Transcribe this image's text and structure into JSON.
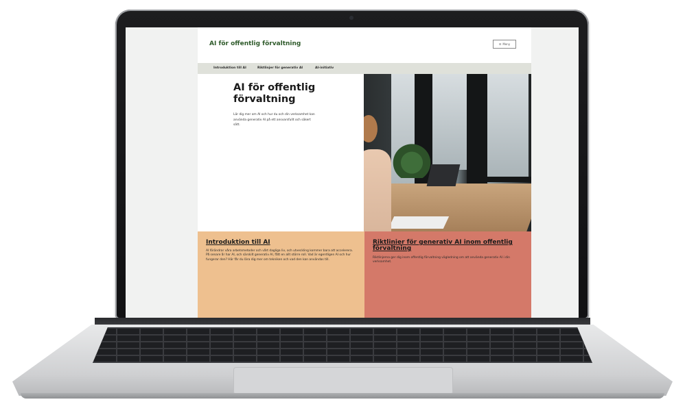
{
  "site": {
    "title": "AI för offentlig förvaltning",
    "menu_label": "Meny"
  },
  "nav": {
    "items": [
      {
        "label": "Introduktion till AI"
      },
      {
        "label": "Riktlinjer för generativ AI"
      },
      {
        "label": "AI-initiativ"
      }
    ]
  },
  "hero": {
    "title": "AI för offentlig förvaltning",
    "text": "Lär dig mer om AI och hur du och din verksamhet kan använda generativ AI på ett ansvarsfullt och säkert sätt."
  },
  "cards": [
    {
      "title": "Introduktion till AI",
      "text": "AI förändrar våra arbetsmetoder och vårt dagliga liv, och utveckling kommer bara att accelerera. På senare år har AI, och särskilt generativ AI, fått en allt större roll. Vad är egentligen AI och hur fungerar den? Här får du lära dig mer om tekniken och vad den kan användas till."
    },
    {
      "title": "Riktlinier för generativ AI inom offentlig förvaltning",
      "text": "Riktlinjerna ger dig inom offentlig förvaltning vägledning om att använda generativ AI i din verksamhet."
    }
  ],
  "colors": {
    "brand_green": "#2e5a2a",
    "nav_bg": "#dfe1da",
    "card_orange": "#eec08f",
    "card_red": "#d47969"
  }
}
